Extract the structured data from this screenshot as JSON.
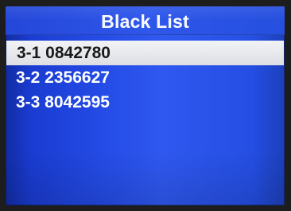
{
  "window": {
    "title": "Black List"
  },
  "blacklist": {
    "items": [
      {
        "label": "3-1 0842780",
        "selected": true
      },
      {
        "label": "3-2 2356627",
        "selected": false
      },
      {
        "label": "3-3 8042595",
        "selected": false
      }
    ]
  },
  "colors": {
    "screen_background": "#244be6",
    "title_text": "#f7f9ff",
    "selected_row": "#e6e8ed",
    "selected_text": "#1a1a1a",
    "normal_text": "#ffffff"
  }
}
